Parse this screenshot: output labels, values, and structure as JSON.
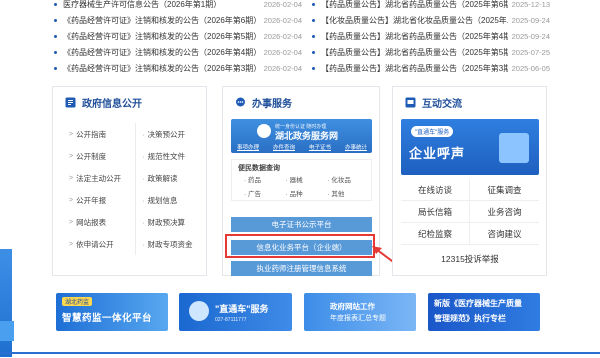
{
  "news": {
    "left": [
      {
        "title": "医疗器械生产许可信息公告（2026年第1期）",
        "date": "2026-02-04"
      },
      {
        "title": "《药品经营许可证》注销和核发的公告（2026年第6期）",
        "date": "2026-02-04"
      },
      {
        "title": "《药品经营许可证》注销和核发的公告（2026年第5期）",
        "date": "2026-02-04"
      },
      {
        "title": "《药品经营许可证》注销和核发的公告（2026年第4期）",
        "date": "2026-02-04"
      },
      {
        "title": "《药品经营许可证》注销和核发的公告（2026年第3期）",
        "date": "2026-02-04"
      }
    ],
    "right": [
      {
        "title": "【药品质量公告】湖北省药品质量公告（2025年第6期）",
        "date": "2025-12-13"
      },
      {
        "title": "【化妆品质量公告】湖北省化妆品质量公告（2025年...",
        "date": "2025-09-24"
      },
      {
        "title": "【药品质量公告】湖北省药品质量公告（2025年第4期）",
        "date": "2025-09-24"
      },
      {
        "title": "【药品质量公告】湖北省药品质量公告（2025年第5期）",
        "date": "2025-07-25"
      },
      {
        "title": "【药品质量公告】湖北省药品质量公告（2025年第3期）",
        "date": "2025-06-05"
      }
    ]
  },
  "gov": {
    "title": "政府信息公开",
    "left": [
      "公开指南",
      "公开制度",
      "法定主动公开",
      "公开年报",
      "网站报表",
      "依申请公开"
    ],
    "right": [
      "决策预公开",
      "规范性文件",
      "政策解读",
      "规划信息",
      "财政预决算",
      "财政专项资金"
    ]
  },
  "service": {
    "title": "办事服务",
    "banner_small": "统一身份认证 随时办理",
    "banner_large": "湖北政务服务网",
    "banner_links": [
      "事项办理",
      "办件查询",
      "电子证书",
      "办事统计"
    ],
    "query_title": "便民数据查询",
    "query_items": [
      "药品",
      "器械",
      "化妆品",
      "广告",
      "品种",
      "其他"
    ],
    "buttons": [
      "电子证书公示平台",
      "信息化业务平台（企业端）",
      "执业药师注册管理信息系统"
    ]
  },
  "interact": {
    "title": "互动交流",
    "promo_tag": "\"直通车\"服务",
    "promo_text": "企业呼声",
    "links": [
      "在线访谈",
      "征集调查",
      "局长信箱",
      "业务咨询",
      "纪检监察",
      "咨询建议"
    ],
    "hotline": "12315投诉举报"
  },
  "banners": {
    "b1_tag": "湖北药监",
    "b1_text": "智慧药监一体化平台",
    "b2_text": "\"直通车\"服务",
    "b2_sub": "027-87111777",
    "b3_text": "政府网站工作",
    "b3_sub": "年度报表汇总专题",
    "b4_text": "新版《医疗器械生产质量",
    "b4_sub": "管理规范》执行专栏"
  }
}
